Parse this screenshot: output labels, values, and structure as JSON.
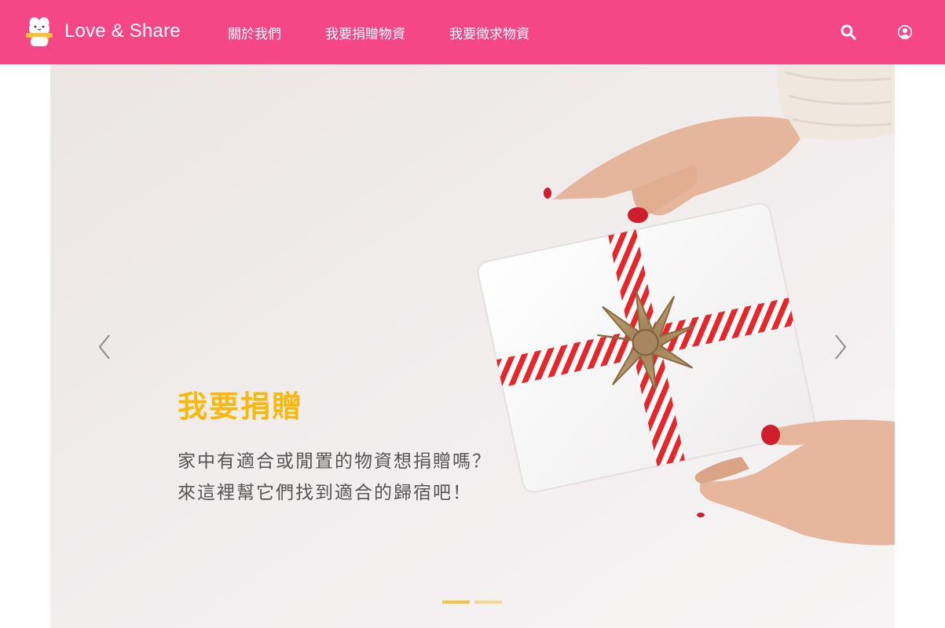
{
  "navbar": {
    "brand_name": "Love & Share",
    "links": [
      "關於我們",
      "我要捐贈物資",
      "我要徵求物資"
    ],
    "icons": [
      "search-icon",
      "user-icon"
    ],
    "color": "#f54785"
  },
  "carousel": {
    "active_slide": {
      "title": "我要捐贈",
      "line1": "家中有適合或閒置的物資想捐贈嗎？",
      "line2": "來這裡幫它們找到適合的歸宿吧！"
    },
    "slide_count": 2,
    "active_index": 1,
    "accent": "#f8b90c",
    "controls": [
      "chevron-left-icon",
      "chevron-right-icon"
    ]
  }
}
